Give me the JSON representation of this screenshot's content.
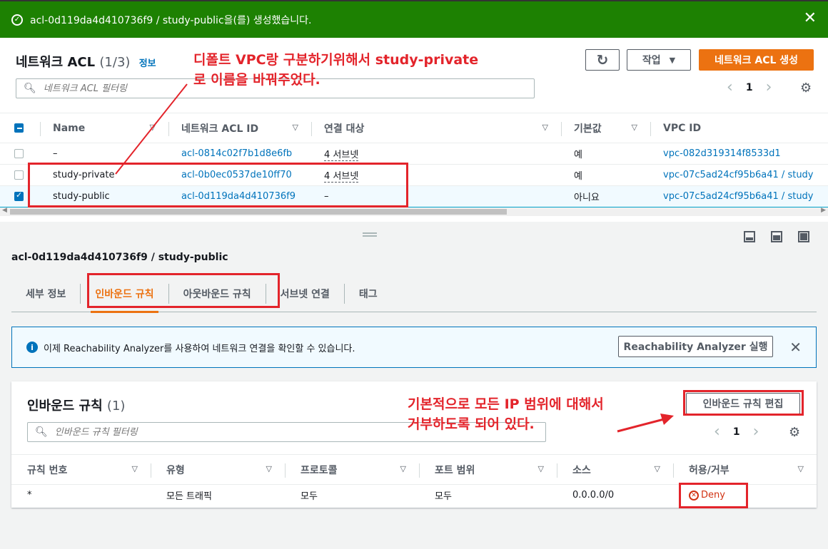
{
  "flash": {
    "message": "acl-0d119da4d410736f9 / study-public을(를) 생성했습니다.",
    "close": "✕",
    "icon": "check-circle-icon"
  },
  "acl_panel": {
    "title": "네트워크 ACL",
    "count": "(1/3)",
    "info": "정보",
    "refresh": "↻",
    "actions_label": "작업",
    "create_label": "네트워크 ACL 생성",
    "search_placeholder": "네트워크 ACL 필터링",
    "page": "1",
    "columns": [
      "Name",
      "네트워크 ACL ID",
      "연결 대상",
      "기본값",
      "VPC ID"
    ],
    "rows": [
      {
        "name": "–",
        "id": "acl-0814c02f7b1d8e6fb",
        "assoc": "4 서브넷",
        "default": "예",
        "vpc": "vpc-082d319314f8533d1",
        "checked": false
      },
      {
        "name": "study-private",
        "id": "acl-0b0ec0537de10ff70",
        "assoc": "4 서브넷",
        "default": "예",
        "vpc": "vpc-07c5ad24cf95b6a41 / study",
        "checked": false
      },
      {
        "name": "study-public",
        "id": "acl-0d119da4d410736f9",
        "assoc": "–",
        "default": "아니요",
        "vpc": "vpc-07c5ad24cf95b6a41 / study",
        "checked": true
      }
    ]
  },
  "detail": {
    "title": "acl-0d119da4d410736f9 / study-public",
    "tabs": [
      "세부 정보",
      "인바운드 규칙",
      "아웃바운드 규칙",
      "서브넷 연결",
      "태그"
    ],
    "active_tab": "인바운드 규칙",
    "info_text": "이제 Reachability Analyzer를 사용하여 네트워크 연결을 확인할 수 있습니다.",
    "info_button": "Reachability Analyzer 실행",
    "info_close": "✕"
  },
  "inbound": {
    "title": "인바운드 규칙",
    "count": "(1)",
    "edit_label": "인바운드 규칙 편집",
    "search_placeholder": "인바운드 규칙 필터링",
    "page": "1",
    "columns": [
      "규칙 번호",
      "유형",
      "프로토콜",
      "포트 범위",
      "소스",
      "허용/거부"
    ],
    "rows": [
      {
        "rule": "*",
        "type": "모든 트래픽",
        "protocol": "모두",
        "port": "모두",
        "source": "0.0.0.0/0",
        "action": "Deny"
      }
    ]
  },
  "annotations": {
    "top_line1": "디폴트 VPC랑 구분하기위해서 study-private",
    "top_line2": "로 이름을 바꿔주었다.",
    "bottom_line1": "기본적으로 모든 IP 범위에 대해서",
    "bottom_line2": "거부하도록 되어 있다."
  },
  "colors": {
    "success": "#1d8102",
    "primary": "#ec7211",
    "link": "#0073bb",
    "annotation": "#e3242b"
  }
}
